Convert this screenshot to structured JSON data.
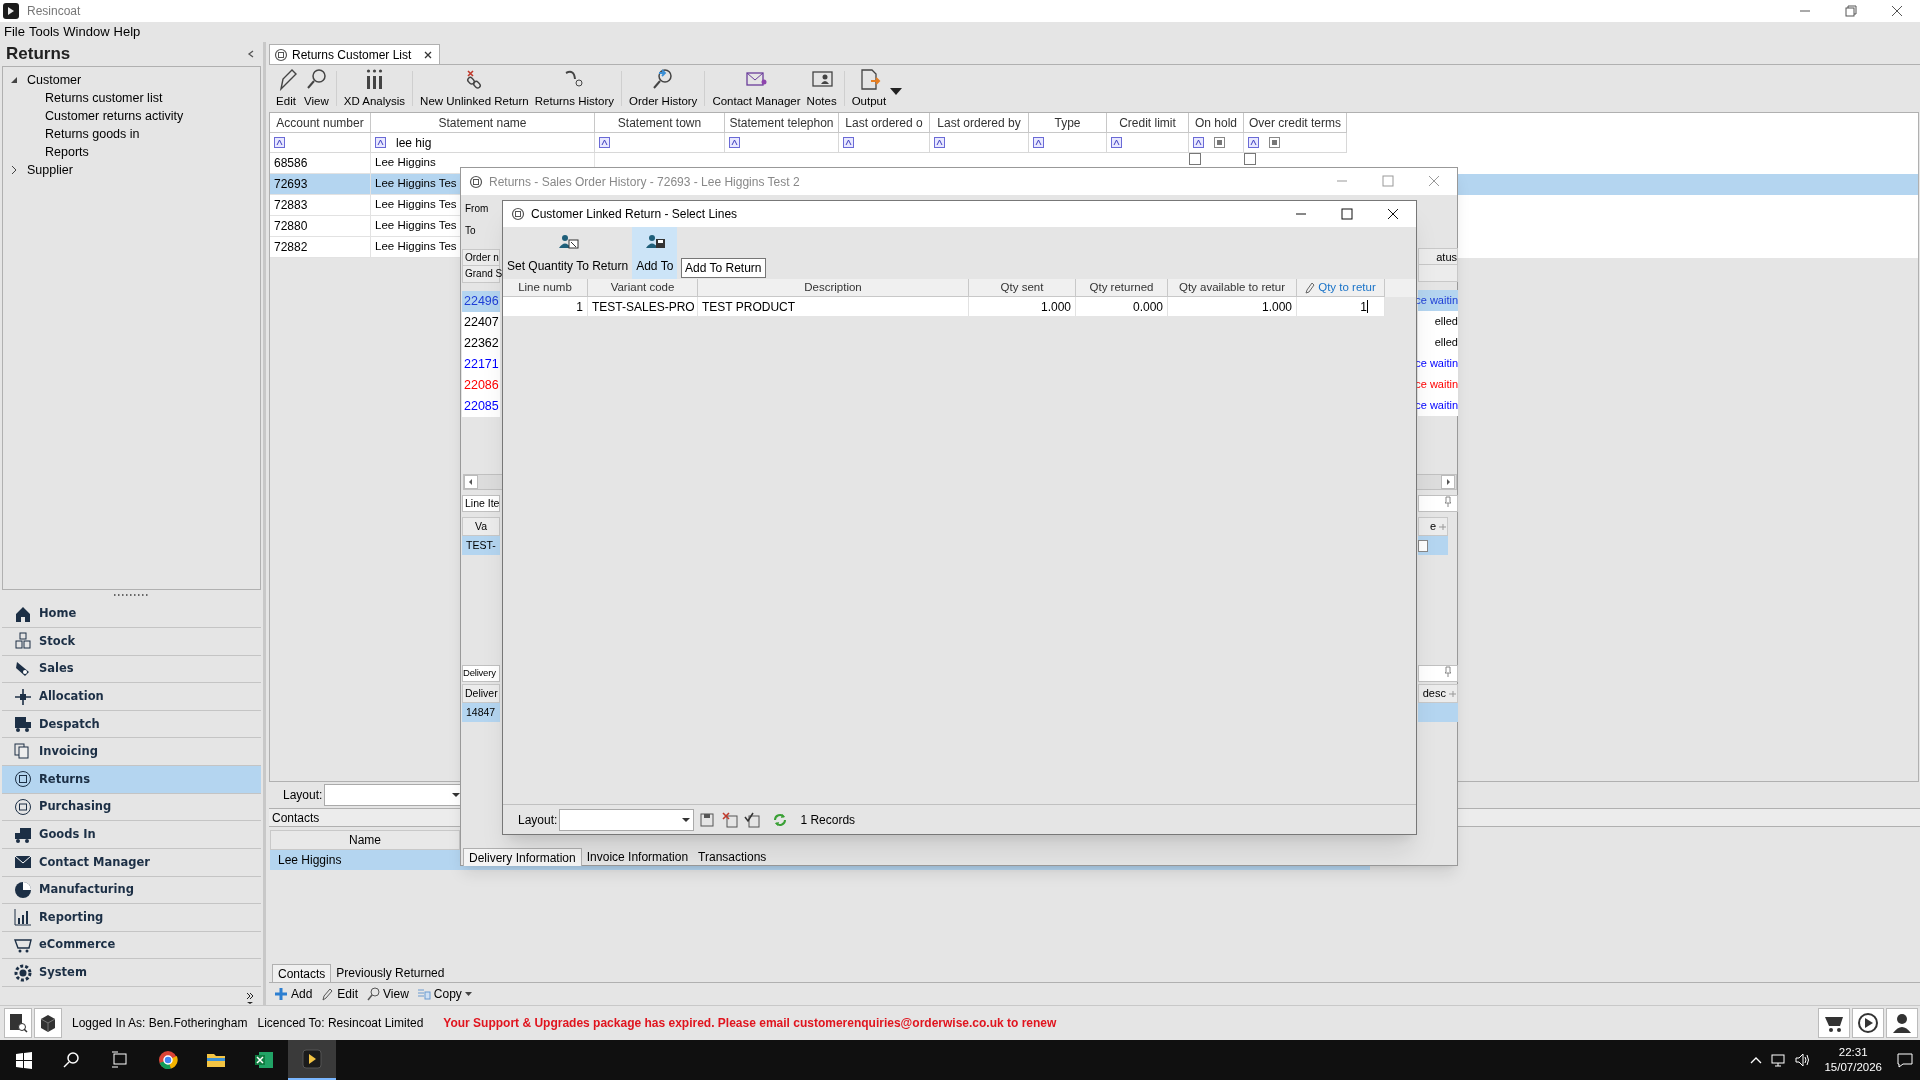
{
  "app": {
    "title": "Resincoat"
  },
  "menu": [
    "File",
    "Tools",
    "Window",
    "Help"
  ],
  "sidebar": {
    "title": "Returns",
    "tree": [
      {
        "label": "Customer",
        "expanded": true,
        "children": [
          {
            "label": "Returns customer list"
          },
          {
            "label": "Customer returns activity"
          },
          {
            "label": "Returns goods in"
          },
          {
            "label": "Reports"
          }
        ]
      },
      {
        "label": "Supplier",
        "expanded": false
      }
    ],
    "nav": [
      {
        "label": "Home",
        "selected": false
      },
      {
        "label": "Stock",
        "selected": false
      },
      {
        "label": "Sales",
        "selected": false
      },
      {
        "label": "Allocation",
        "selected": false
      },
      {
        "label": "Despatch",
        "selected": false
      },
      {
        "label": "Invoicing",
        "selected": false
      },
      {
        "label": "Returns",
        "selected": true
      },
      {
        "label": "Purchasing",
        "selected": false
      },
      {
        "label": "Goods In",
        "selected": false
      },
      {
        "label": "Contact Manager",
        "selected": false
      },
      {
        "label": "Manufacturing",
        "selected": false
      },
      {
        "label": "Reporting",
        "selected": false
      },
      {
        "label": "eCommerce",
        "selected": false
      },
      {
        "label": "System",
        "selected": false
      }
    ]
  },
  "document_tab": {
    "label": "Returns Customer List"
  },
  "toolbar": [
    "Edit",
    "View",
    "XD Analysis",
    "New Unlinked Return",
    "Returns History",
    "Order History",
    "Contact Manager",
    "Notes",
    "Output"
  ],
  "grid": {
    "columns": [
      "Account number",
      "Statement name",
      "Statement town",
      "Statement telephon",
      "Last ordered o",
      "Last ordered by",
      "Type",
      "Credit limit",
      "On hold",
      "Over credit terms"
    ],
    "filter": {
      "statement_name": "lee hig"
    },
    "rows": [
      {
        "selected": false,
        "cells": [
          "68586",
          "Lee Higgins"
        ],
        "on_hold": false,
        "over_credit_terms": false
      },
      {
        "selected": true,
        "cells": [
          "72693",
          "Lee Higgins Tes"
        ]
      },
      {
        "selected": false,
        "cells": [
          "72883",
          "Lee Higgins Tes"
        ]
      },
      {
        "selected": false,
        "cells": [
          "72880",
          "Lee Higgins Tes"
        ]
      },
      {
        "selected": false,
        "cells": [
          "72882",
          "Lee Higgins Tes"
        ]
      }
    ]
  },
  "layout_bar": {
    "label": "Layout:"
  },
  "contacts": {
    "title": "Contacts",
    "column": "Name",
    "rows": [
      {
        "name": "Lee Higgins",
        "selected": true
      }
    ],
    "tabs": [
      {
        "label": "Contacts",
        "selected": true
      },
      {
        "label": "Previously Returned",
        "selected": false
      }
    ],
    "actions": [
      "Add",
      "Edit",
      "View",
      "Copy"
    ]
  },
  "history_dialog": {
    "title": "Returns - Sales Order History - 72693 - Lee Higgins Test 2",
    "from_label": "From",
    "to_label": "To",
    "order_header": "Order n",
    "grand_total": "Grand S",
    "status_header": "atus",
    "orders": [
      {
        "number": "22496",
        "status": "ce waitin",
        "color": "#1f3fd6",
        "selected": true
      },
      {
        "number": "22407",
        "status": "elled",
        "color": "#000000",
        "selected": false
      },
      {
        "number": "22362",
        "status": "elled",
        "color": "#000000",
        "selected": false
      },
      {
        "number": "22171",
        "status": "ce waitin",
        "color": "#0000ff",
        "selected": false
      },
      {
        "number": "22086",
        "status": "ce waitin",
        "color": "#ff0000",
        "selected": false
      },
      {
        "number": "22085",
        "status": "ce waitin",
        "color": "#0000ff",
        "selected": false
      }
    ],
    "line_items": {
      "title": "Line Ite",
      "column": "Va",
      "right_column": "e",
      "row": "TEST-",
      "checked": false
    },
    "delivery": {
      "title": "Delivery",
      "column": "Deliver",
      "right_column": "desc",
      "row": "14847"
    },
    "tabs": [
      {
        "label": "Delivery Information",
        "selected": true
      },
      {
        "label": "Invoice Information",
        "selected": false
      },
      {
        "label": "Transactions",
        "selected": false
      }
    ]
  },
  "select_dialog": {
    "title": "Customer Linked Return - Select Lines",
    "toolbar": [
      {
        "label": "Set Quantity To Return",
        "selected": false
      },
      {
        "label": "Add To",
        "selected": true
      }
    ],
    "tooltip": "Add To Return",
    "columns": [
      "Line numb",
      "Variant code",
      "Description",
      "Qty sent",
      "Qty returned",
      "Qty available to retur",
      "Qty to retur"
    ],
    "rows": [
      {
        "cells": [
          "1",
          "TEST-SALES-PRO",
          "TEST PRODUCT",
          "1.000",
          "0.000",
          "1.000",
          "1"
        ]
      }
    ],
    "layout_label": "Layout:",
    "records": "1 Records"
  },
  "status_bar": {
    "user": "Logged In As: Ben.Fotheringham",
    "licence": "Licenced To: Resincoat Limited",
    "alert": "Your Support & Upgrades package has expired. Please email customerenquiries@orderwise.co.uk to renew"
  },
  "taskbar": {
    "time": "22:31",
    "date": "15/07/2026"
  }
}
